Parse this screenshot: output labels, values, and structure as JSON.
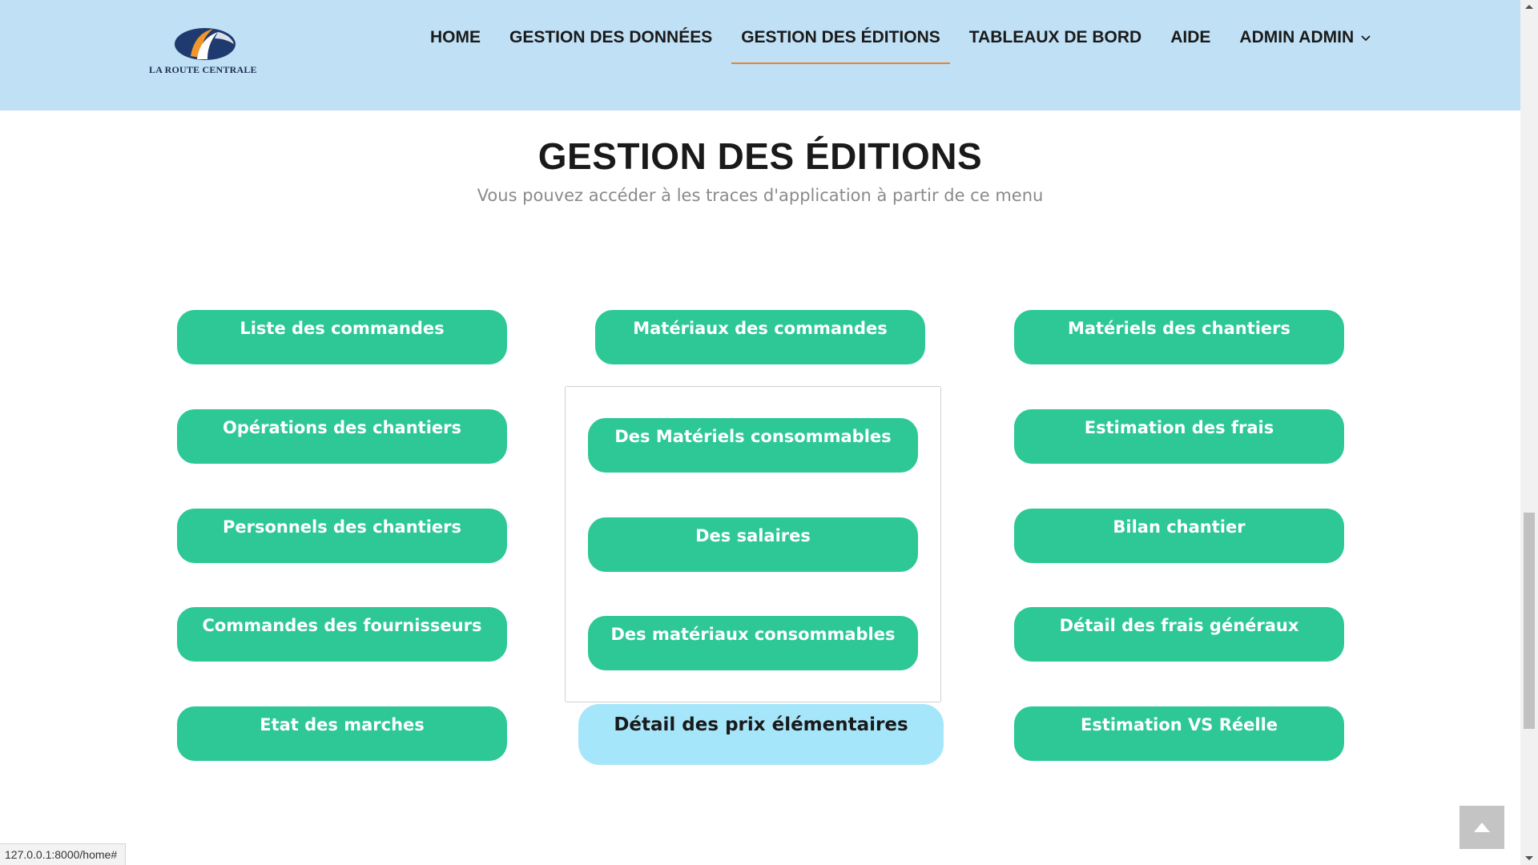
{
  "header": {
    "logo_text": "LA ROUTE CENTRALE",
    "nav": [
      {
        "label": "HOME"
      },
      {
        "label": "GESTION DES DONNÉES"
      },
      {
        "label": "GESTION DES ÉDITIONS"
      },
      {
        "label": "TABLEAUX DE BORD"
      },
      {
        "label": "AIDE"
      },
      {
        "label": "ADMIN ADMIN"
      }
    ],
    "active_nav": "GESTION DES ÉDITIONS"
  },
  "main": {
    "title": "GESTION DES ÉDITIONS",
    "subtitle": "Vous pouvez accéder à les traces d'application à partir de ce menu",
    "left_column": [
      "Liste des commandes",
      "Opérations des chantiers",
      "Personnels des chantiers",
      "Commandes des fournisseurs",
      "Etat des marches"
    ],
    "middle_column": {
      "top": "Matériaux des commandes",
      "group": [
        "Des Matériels consommables",
        "Des salaires",
        "Des matériaux consommables"
      ],
      "bottom_highlighted": "Détail des prix élémentaires"
    },
    "right_column": [
      "Matériels des chantiers",
      "Estimation des frais",
      "Bilan chantier",
      "Détail des frais généraux",
      "Estimation VS Réelle"
    ]
  },
  "status_bar": {
    "url": "127.0.0.1:8000/home#"
  },
  "colors": {
    "header_bg": "#bfe0f5",
    "button_green": "#2dc896",
    "button_highlight": "#a6e6fb",
    "active_underline": "#e8852f",
    "logo_navy": "#1f3a6e",
    "logo_orange": "#f0962a"
  },
  "icons": {
    "dropdown": "chevron-down-icon",
    "back_to_top": "chevron-up-icon"
  }
}
